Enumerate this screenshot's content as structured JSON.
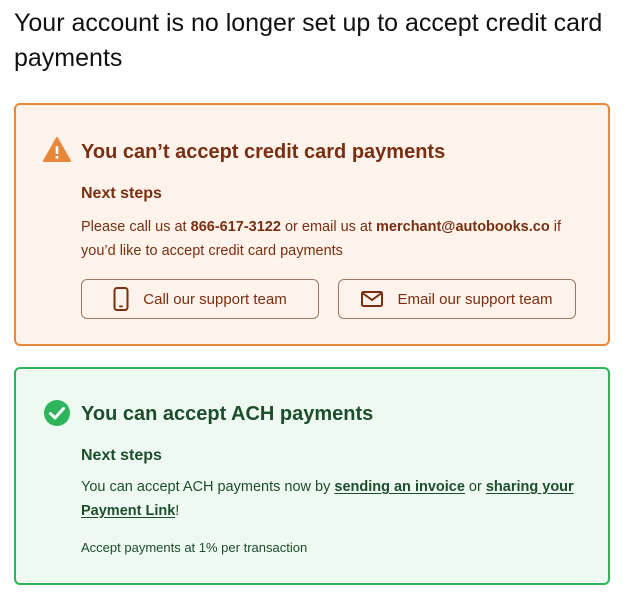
{
  "page": {
    "title": "Your account is no longer set up to accept credit card payments"
  },
  "credit_card": {
    "title": "You can’t accept credit card payments",
    "icon": "warning-icon",
    "steps_heading": "Next steps",
    "message_before_phone": "Please call us at ",
    "phone": "866-617-3122",
    "message_middle": " or email us at ",
    "email": "merchant@autobooks.co",
    "message_after_email": " if you’d like to accept credit card payments",
    "call_button": {
      "label": "Call our support team",
      "icon": "mobile-phone-icon"
    },
    "email_button": {
      "label": "Email our support team",
      "icon": "envelope-icon"
    },
    "colors": {
      "border": "#e8863a",
      "background": "#fdf3ea",
      "text": "#7a2e12"
    }
  },
  "ach": {
    "title": "You can accept ACH payments",
    "icon": "check-circle-icon",
    "steps_heading": "Next steps",
    "message_before": "You can accept ACH payments now by ",
    "link_invoice": "sending an invoice",
    "message_middle": " or ",
    "link_payment": "sharing your Payment Link",
    "message_after": "!",
    "fee_note": "Accept payments at 1% per transaction",
    "colors": {
      "border": "#2eb45a",
      "background": "#eefaf1",
      "text": "#1d4d2c"
    }
  }
}
